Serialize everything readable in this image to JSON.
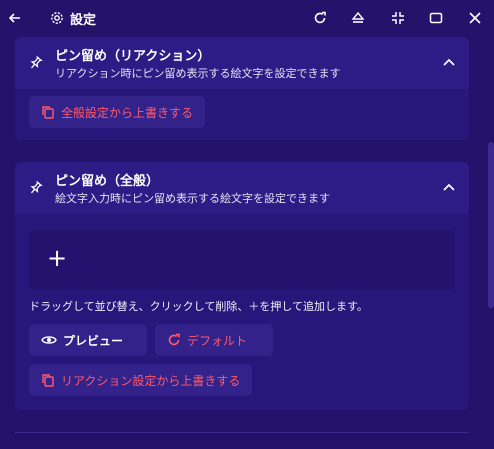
{
  "header": {
    "title": "設定",
    "back_icon": "arrow-left-icon",
    "settings_icon": "gear-icon",
    "actions": [
      "refresh-icon",
      "eject-icon",
      "collapse-icon",
      "maximize-icon",
      "close-icon"
    ]
  },
  "sections": [
    {
      "title": "ピン留め（リアクション）",
      "description": "リアクション時にピン留め表示する絵文字を設定できます",
      "buttons": {
        "overwrite_general": "全般設定から上書きする"
      }
    },
    {
      "title": "ピン留め（全般）",
      "description": "絵文字入力時にピン留め表示する絵文字を設定できます",
      "add_label": "+",
      "hint": "ドラッグして並び替え、クリックして削除、＋を押して追加します。",
      "buttons": {
        "preview": "プレビュー",
        "default": "デフォルト",
        "overwrite_reaction": "リアクション設定から上書きする"
      }
    }
  ],
  "colors": {
    "background": "#22126a",
    "section": "#28177a",
    "section_header": "#2e1c86",
    "button": "#33228a",
    "danger": "#ff5a6e"
  }
}
